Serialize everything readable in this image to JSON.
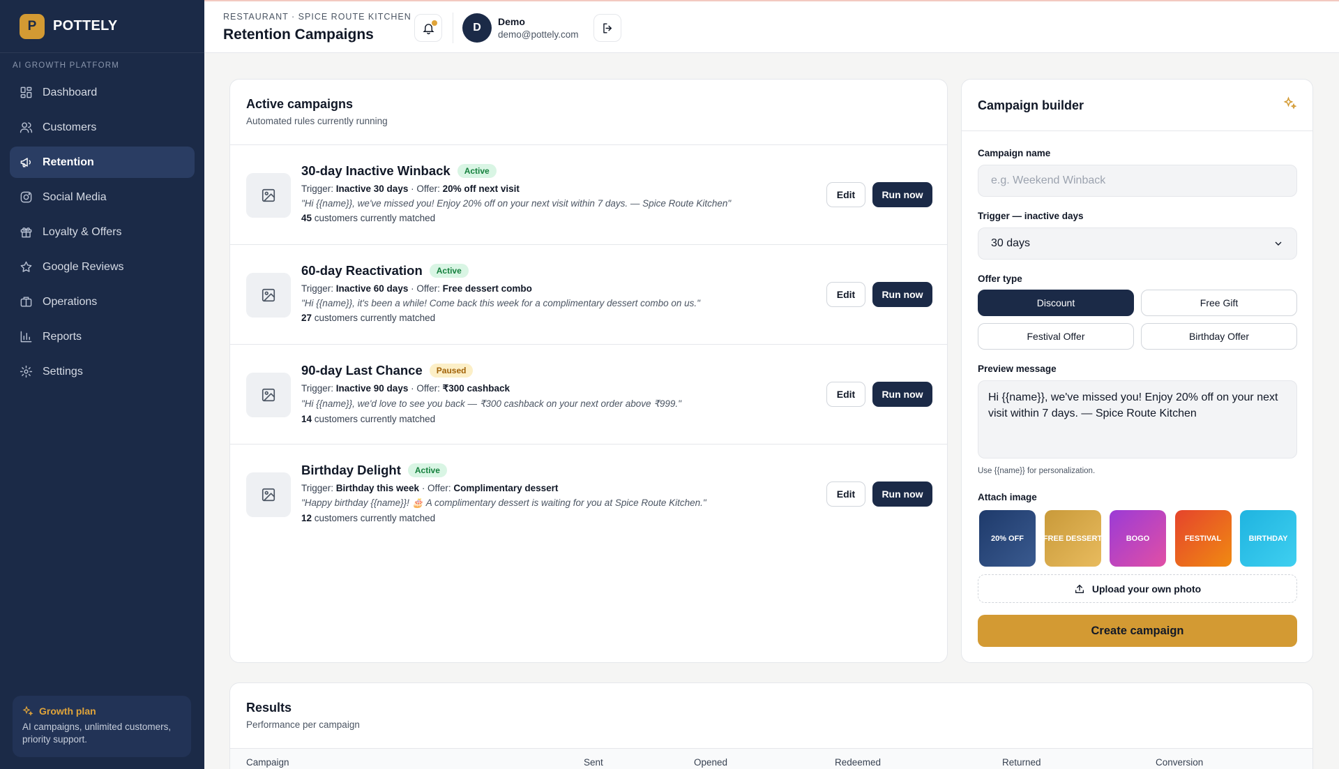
{
  "brand": {
    "logo_letter": "P",
    "name": "POTTELY",
    "platform_label": "AI GROWTH PLATFORM"
  },
  "sidebar": {
    "items": [
      {
        "label": "Dashboard",
        "icon": "dashboard-icon"
      },
      {
        "label": "Customers",
        "icon": "users-icon"
      },
      {
        "label": "Retention",
        "icon": "megaphone-icon",
        "active": true
      },
      {
        "label": "Social Media",
        "icon": "instagram-icon"
      },
      {
        "label": "Loyalty & Offers",
        "icon": "gift-icon"
      },
      {
        "label": "Google Reviews",
        "icon": "star-icon"
      },
      {
        "label": "Operations",
        "icon": "briefcase-icon"
      },
      {
        "label": "Reports",
        "icon": "bar-chart-icon"
      },
      {
        "label": "Settings",
        "icon": "gear-icon"
      }
    ],
    "plan": {
      "title": "Growth plan",
      "desc": "AI campaigns, unlimited customers, priority support."
    }
  },
  "header": {
    "breadcrumb": "RESTAURANT · SPICE ROUTE KITCHEN",
    "title": "Retention Campaigns",
    "user": {
      "initial": "D",
      "name": "Demo",
      "email": "demo@pottely.com"
    }
  },
  "active_campaigns": {
    "title": "Active campaigns",
    "subtitle": "Automated rules currently running",
    "trigger_prefix": "Trigger: ",
    "offer_prefix": " · Offer: ",
    "matched_suffix": " customers currently matched",
    "edit_label": "Edit",
    "run_label": "Run now",
    "rows": [
      {
        "name": "30-day Inactive Winback",
        "status": "Active",
        "trigger": "Inactive 30 days",
        "offer": "20% off next visit",
        "message": "\"Hi {{name}}, we've missed you! Enjoy 20% off on your next visit within 7 days. — Spice Route Kitchen\"",
        "matched": "45"
      },
      {
        "name": "60-day Reactivation",
        "status": "Active",
        "trigger": "Inactive 60 days",
        "offer": "Free dessert combo",
        "message": "\"Hi {{name}}, it's been a while! Come back this week for a complimentary dessert combo on us.\"",
        "matched": "27"
      },
      {
        "name": "90-day Last Chance",
        "status": "Paused",
        "trigger": "Inactive 90 days",
        "offer": "₹300 cashback",
        "message": "\"Hi {{name}}, we'd love to see you back — ₹300 cashback on your next order above ₹999.\"",
        "matched": "14"
      },
      {
        "name": "Birthday Delight",
        "status": "Active",
        "trigger": "Birthday this week",
        "offer": "Complimentary dessert",
        "message": "\"Happy birthday {{name}}! 🎂 A complimentary dessert is waiting for you at Spice Route Kitchen.\"",
        "matched": "12"
      }
    ]
  },
  "builder": {
    "title": "Campaign builder",
    "name_label": "Campaign name",
    "name_placeholder": "e.g. Weekend Winback",
    "trigger_label": "Trigger — inactive days",
    "trigger_value": "30 days",
    "offer_label": "Offer type",
    "offers": [
      "Discount",
      "Free Gift",
      "Festival Offer",
      "Birthday Offer"
    ],
    "selected_offer": "Discount",
    "preview_label": "Preview message",
    "preview_text": "Hi {{name}}, we've missed you! Enjoy 20% off on your next visit within 7 days. — Spice Route Kitchen",
    "hint": "Use {{name}} for personalization.",
    "attach_label": "Attach image",
    "images": [
      {
        "label": "20% OFF",
        "from": "#1e3a6b",
        "to": "#3a5a8f"
      },
      {
        "label": "FREE DESSERT",
        "from": "#c99a3a",
        "to": "#e8bb5e"
      },
      {
        "label": "BOGO",
        "from": "#9b3bd6",
        "to": "#e14fa5"
      },
      {
        "label": "FESTIVAL",
        "from": "#e5442c",
        "to": "#f08a12"
      },
      {
        "label": "BIRTHDAY",
        "from": "#1fb4e0",
        "to": "#3fcff0"
      }
    ],
    "upload_label": "Upload your own photo",
    "create_label": "Create campaign"
  },
  "results": {
    "title": "Results",
    "subtitle": "Performance per campaign",
    "columns": [
      "Campaign",
      "Sent",
      "Opened",
      "Redeemed",
      "Returned",
      "Conversion"
    ]
  },
  "colors": {
    "navy": "#1b2a47",
    "gold": "#d39a33",
    "active_badge": "#d9f5e4",
    "paused_badge": "#fcefc7"
  }
}
